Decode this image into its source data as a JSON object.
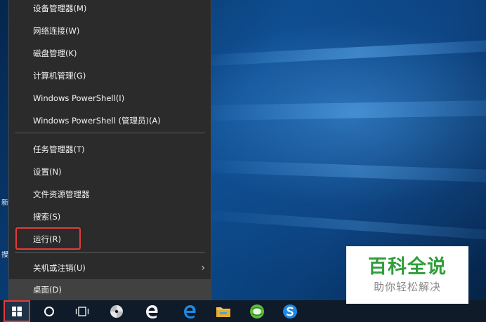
{
  "menu": {
    "items": [
      {
        "label": "设备管理器(M)"
      },
      {
        "label": "网络连接(W)"
      },
      {
        "label": "磁盘管理(K)"
      },
      {
        "label": "计算机管理(G)"
      },
      {
        "label": "Windows PowerShell(I)"
      },
      {
        "label": "Windows PowerShell (管理员)(A)"
      },
      {
        "label": "任务管理器(T)"
      },
      {
        "label": "设置(N)"
      },
      {
        "label": "文件资源管理器"
      },
      {
        "label": "搜索(S)"
      },
      {
        "label": "运行(R)",
        "highlighted": true
      },
      {
        "label": "关机或注销(U)",
        "has_submenu": true
      },
      {
        "label": "桌面(D)",
        "active": true
      }
    ],
    "submenu_arrow": "›",
    "highlight_color": "#e03c3c"
  },
  "desktop": {
    "stub_texts": [
      "新",
      "搜"
    ]
  },
  "taskbar": {
    "icons": [
      "windows-start-icon",
      "cortana-circle-icon",
      "task-view-icon",
      "pinwheel-app-icon",
      "edge-legacy-icon",
      "edge-icon",
      "file-explorer-icon",
      "green-browser-icon",
      "sogou-icon"
    ]
  },
  "watermark": {
    "title": "百科全说",
    "subtitle": "助你轻松解决",
    "title_color": "#2f9e3a"
  }
}
